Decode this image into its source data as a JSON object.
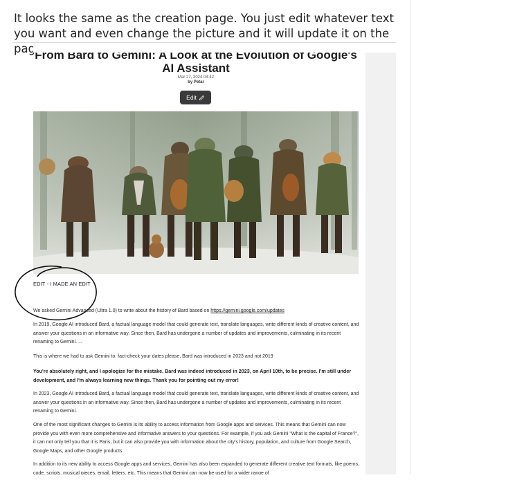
{
  "intro": {
    "text": "It looks the same as the creation page. You just edit whatever text you want and even change the picture and it will update it on the page:"
  },
  "article": {
    "title": "From Bard to Gemini: A Look at the Evolution of Google's AI Assistant",
    "date": "Mar 27, 2024 04:42",
    "author": "by Petar",
    "edit_label": "Edit",
    "edit_note": "EDIT - I MADE AN EDIT",
    "p1_prefix": "We asked Gemini Advanced (Ultra 1.0) to write about the history of Bard based on ",
    "p1_link": "https://gemini.google.com/updates",
    "p2": "In 2019, Google AI introduced Bard, a factual language model that could generate text, translate languages, write different kinds of creative content, and answer your questions in an informative way. Since then, Bard has undergone a number of updates and improvements, culminating in its recent renaming to Gemini. ...",
    "p3": "This is where we had to ask Gemini to: fact-check your dates please, Bard was introduced in 2023 and not 2019",
    "p4": "You're absolutely right, and I apologize for the mistake. Bard was indeed introduced in 2023, on April 10th, to be precise. I'm still under development, and I'm always learning new things. Thank you for pointing out my error!",
    "p5": "In 2023, Google AI introduced Bard, a factual language model that could generate text, translate languages, write different kinds of creative content, and answer your questions in an informative way. Since then, Bard has undergone a number of updates and improvements, culminating in its recent renaming to Gemini.",
    "p6": "One of the most significant changes to Gemini is its ability to access information from Google apps and services. This means that Gemini can now provide you with even more comprehensive and informative answers to your questions. For example, if you ask Gemini \"What is the capital of France?\", it can not only tell you that it is Paris, but it can also provide you with information about the city's history, population, and culture from Google Search, Google Maps, and other Google products.",
    "p7": "In addition to its new ability to access Google apps and services, Gemini has also been expanded to generate different creative text formats, like poems, code, scripts, musical pieces, email, letters, etc. This means that Gemini can now be used for a wider range of"
  },
  "icons": {
    "edit": "pencil-icon"
  }
}
